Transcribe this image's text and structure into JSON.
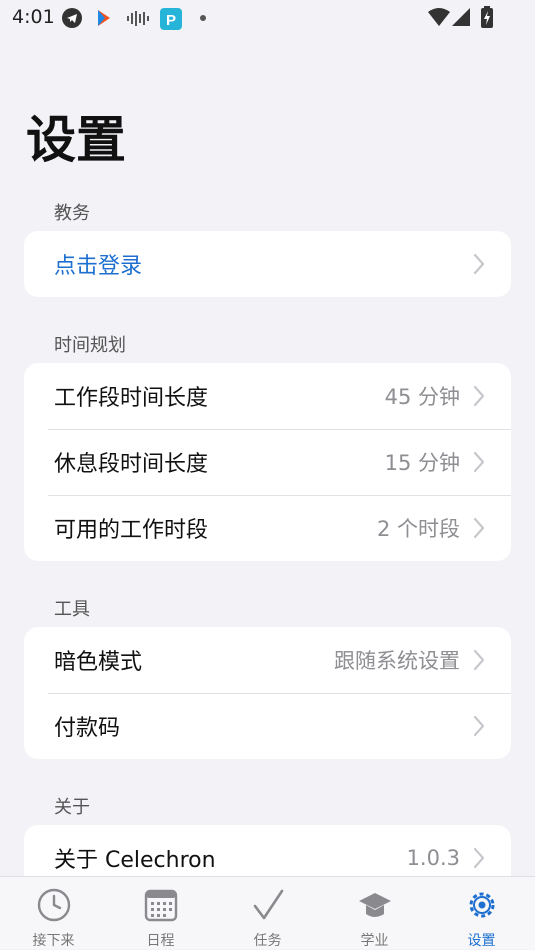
{
  "status_bar": {
    "time": "4:01",
    "icons": [
      "telegram-icon",
      "play-store-icon",
      "audio-wave-icon",
      "p-app-icon",
      "dot-icon"
    ],
    "right_icons": [
      "wifi-icon",
      "signal-icon",
      "battery-charging-icon"
    ]
  },
  "page": {
    "title": "设置"
  },
  "sections": {
    "academic": {
      "header": "教务",
      "login": {
        "label": "点击登录"
      }
    },
    "time_planning": {
      "header": "时间规划",
      "work_length": {
        "label": "工作段时间长度",
        "value": "45 分钟"
      },
      "rest_length": {
        "label": "休息段时间长度",
        "value": "15 分钟"
      },
      "work_periods": {
        "label": "可用的工作时段",
        "value": "2 个时段"
      }
    },
    "tools": {
      "header": "工具",
      "dark_mode": {
        "label": "暗色模式",
        "value": "跟随系统设置"
      },
      "payment_code": {
        "label": "付款码"
      }
    },
    "about": {
      "header": "关于",
      "about_app": {
        "label": "关于 Celechron",
        "value": "1.0.3"
      }
    }
  },
  "bottom_nav": {
    "items": [
      {
        "label": "接下来",
        "icon": "clock-icon"
      },
      {
        "label": "日程",
        "icon": "calendar-icon"
      },
      {
        "label": "任务",
        "icon": "checkmark-icon"
      },
      {
        "label": "学业",
        "icon": "graduation-cap-icon"
      },
      {
        "label": "设置",
        "icon": "gear-icon"
      }
    ],
    "active_index": 4
  },
  "colors": {
    "background": "#f2f2f7",
    "card": "#ffffff",
    "accent": "#1e6fd0",
    "secondary_text": "#8e8e93"
  }
}
